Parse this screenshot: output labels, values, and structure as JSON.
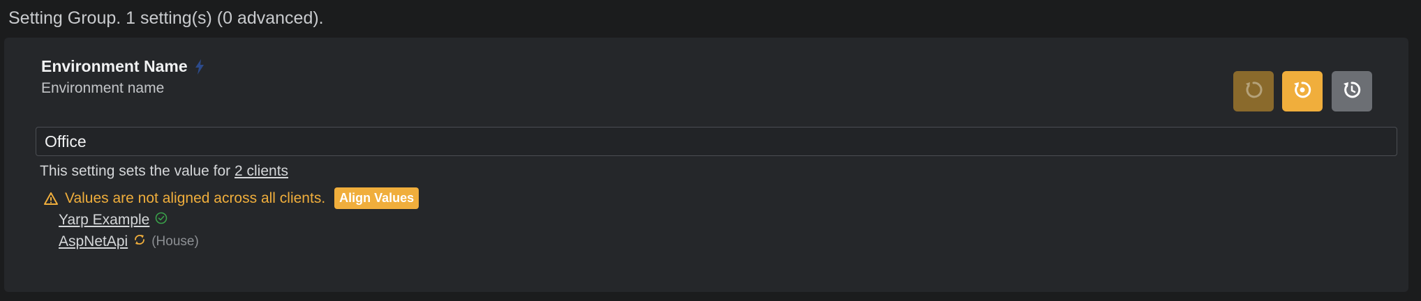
{
  "group_header": "Setting Group. 1 setting(s) (0 advanced).",
  "setting": {
    "title": "Environment Name",
    "description": "Environment name",
    "value": "Office"
  },
  "toolbar": {
    "undo_icon": "undo-icon",
    "reset_icon": "reset-to-default-icon",
    "history_icon": "history-icon"
  },
  "clients_line": {
    "prefix": "This setting sets the value for",
    "link": "2 clients"
  },
  "warning": {
    "text": "Values are not aligned across all clients.",
    "align_button": "Align Values"
  },
  "clients": [
    {
      "name": "Yarp Example",
      "status_icon": "check-circle-icon",
      "note": ""
    },
    {
      "name": "AspNetApi",
      "status_icon": "sync-icon",
      "note": "(House)"
    }
  ],
  "colors": {
    "accent": "#f0ae3c",
    "success": "#3aa24a",
    "panel": "#25272a",
    "background": "#1b1c1d"
  }
}
